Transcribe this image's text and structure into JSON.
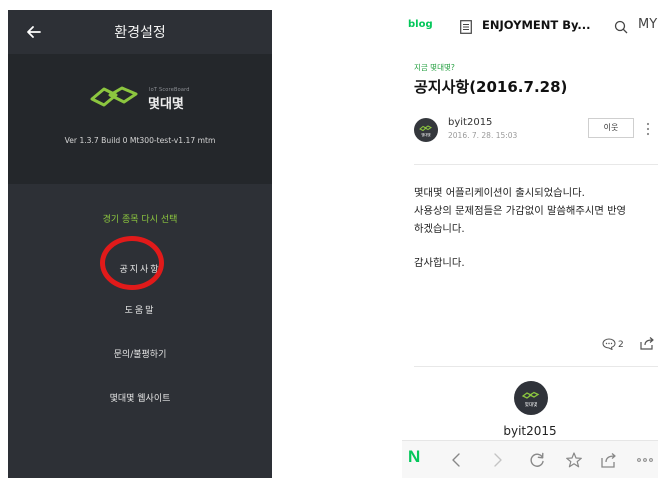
{
  "left": {
    "header_title": "환경설정",
    "brand_small": "IoT ScoreBoard",
    "brand_name": "몇대몇",
    "version": "Ver 1.3.7 Build 0 Mt300-test-v1.17 mtm",
    "menu": [
      {
        "label": "경기 종목 다시 선택"
      },
      {
        "label": "공지사항"
      },
      {
        "label": "도움말"
      },
      {
        "label": "문의/불평하기"
      },
      {
        "label": "몇대몇 웹사이트"
      }
    ]
  },
  "right": {
    "blog_logo": "blog",
    "blog_title": "ENJOYMENT By...",
    "my_label": "MY",
    "category": "지금 몇대몇?",
    "post_title": "공지사항(2016.7.28)",
    "author": "byit2015",
    "date": "2016. 7. 28. 15:03",
    "neighbor_button": "이웃",
    "avatar_text": "몇대몇",
    "body_lines": [
      "몇대몇 어플리케이션이 출시되었습니다.",
      "사용상의 문제점들은 가감없이 말씀해주시면 반영",
      "하겠습니다.",
      "감사합니다."
    ],
    "comment_count": "2",
    "author_bottom": "byit2015",
    "bottom_nav_logo": "N"
  },
  "colors": {
    "left_bg": "#2d3036",
    "green_accent": "#8cc63f",
    "highlight_red": "#e11a1a",
    "naver_green": "#03c75a"
  }
}
